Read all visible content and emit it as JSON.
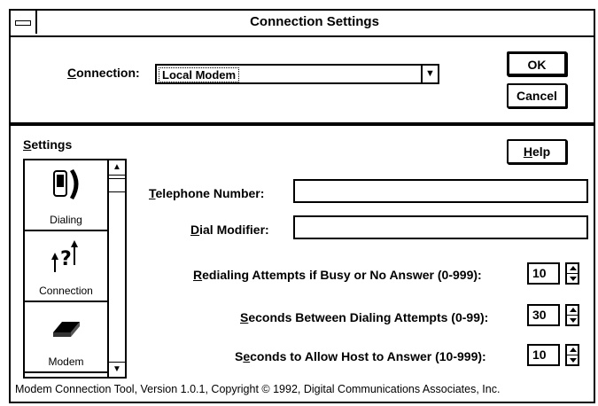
{
  "window": {
    "title": "Connection Settings"
  },
  "connection": {
    "label_key": "C",
    "label_rest": "onnection:",
    "value": "Local Modem"
  },
  "buttons": {
    "ok": "OK",
    "cancel": "Cancel",
    "help_key": "H",
    "help_rest": "elp"
  },
  "settings": {
    "label_key": "S",
    "label_rest": "ettings",
    "items": [
      {
        "label": "Dialing",
        "icon": "telephone-icon"
      },
      {
        "label": "Connection",
        "icon": "connection-icon"
      },
      {
        "label": "Modem",
        "icon": "modem-icon"
      }
    ]
  },
  "fields": {
    "telephone": {
      "key": "T",
      "rest": "elephone Number:",
      "value": ""
    },
    "dial_modifier": {
      "pre": "",
      "key": "D",
      "rest": "ial Modifier:",
      "value": ""
    },
    "redial": {
      "key": "R",
      "rest": "edialing Attempts if Busy or No Answer (0-999):",
      "value": "10"
    },
    "between": {
      "key": "S",
      "rest": "econds Between Dialing Attempts (0-99):",
      "value": "30"
    },
    "host": {
      "pre": "S",
      "key": "e",
      "rest": "conds to Allow Host to Answer (10-999):",
      "value": "10"
    }
  },
  "status": "Modem Connection Tool,  Version 1.0.1, Copyright © 1992, Digital Communications Associates, Inc."
}
